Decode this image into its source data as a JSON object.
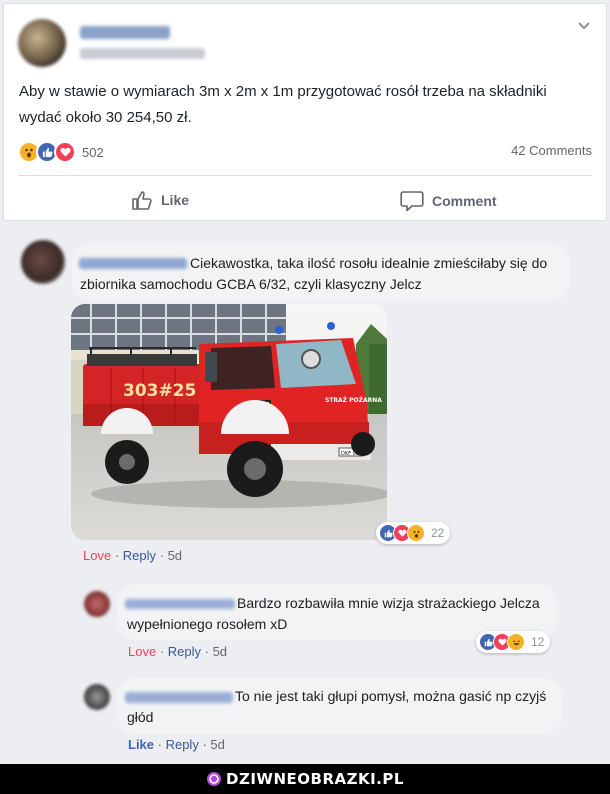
{
  "post": {
    "text": "Aby w stawie o wymiarach 3m x 2m x 1m przygotować rosół trzeba na składniki wydać około 30 254,50 zł.",
    "reaction_count": "502",
    "comments_count": "42 Comments",
    "like_label": "Like",
    "comment_label": "Comment",
    "reactions": [
      "wow",
      "like",
      "love"
    ]
  },
  "comments": [
    {
      "text": "Ciekawostka, taka ilość rosołu idealnie zmieściłaby się do zbiornika samochodu GCBA 6/32, czyli klasyczny Jelcz",
      "reaction_count": "22",
      "reactions": [
        "like",
        "love",
        "wow"
      ],
      "love_label": "Love",
      "reply_label": "Reply",
      "time": "5d",
      "photo": {
        "truck_number": "303#25",
        "door_text": "STRAŻ POŻARNA",
        "plate": "DKF 0000"
      }
    },
    {
      "text": "Bardzo rozbawiła mnie wizja strażackiego Jelcza wypełnionego rosołem xD",
      "reaction_count": "12",
      "reactions": [
        "like",
        "love",
        "haha"
      ],
      "love_label": "Love",
      "reply_label": "Reply",
      "time": "5d"
    },
    {
      "text": "To nie jest taki głupi pomysł, można gasić np czyjś głód",
      "like_label": "Like",
      "reply_label": "Reply",
      "time": "5d"
    }
  ],
  "footer": {
    "brand": "DZIWNEOBRAZKI.PL"
  },
  "colors": {
    "like_blue": "#4267b2",
    "love_red": "#f33e58",
    "wow_yellow": "#f7b125",
    "footer_bg": "#000000"
  }
}
